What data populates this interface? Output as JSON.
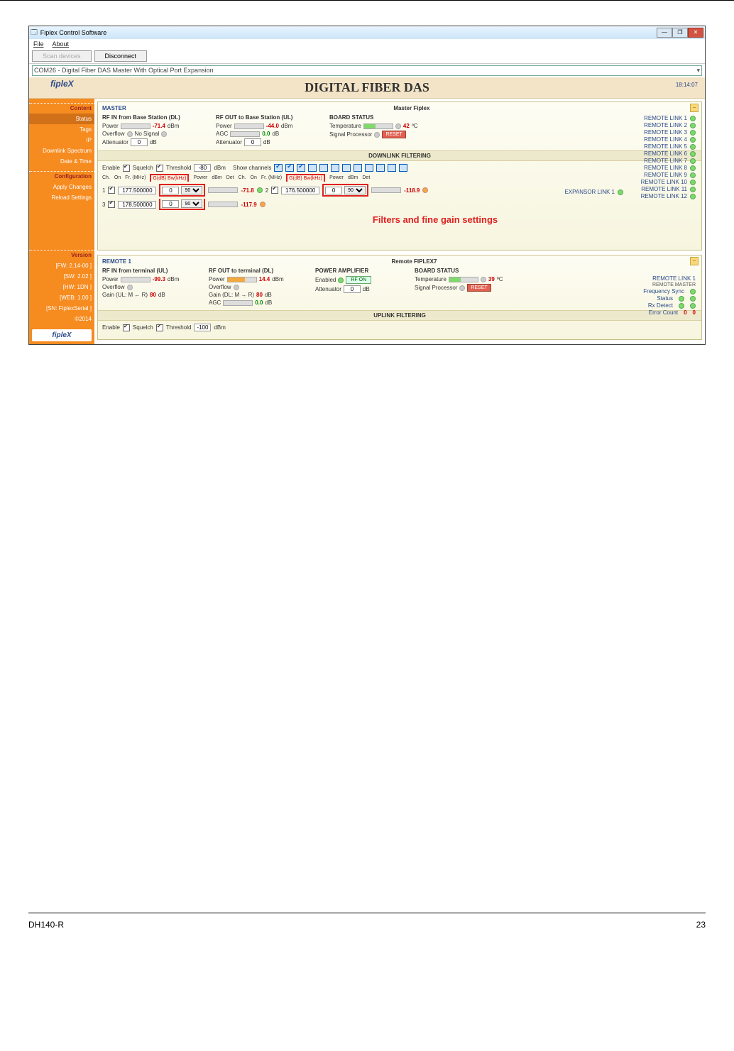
{
  "window": {
    "title": "Fiplex Control Software"
  },
  "menu": {
    "file": "File",
    "about": "About"
  },
  "toolbar": {
    "scan": "Scan devices",
    "disconnect": "Disconnect"
  },
  "combo": "COM26 - Digital Fiber DAS Master With Optical Port Expansion",
  "banner": {
    "logo": "fipleX",
    "title": "DIGITAL FIBER DAS",
    "time": "18:14:07"
  },
  "sidebar": {
    "content": "Content",
    "status": "Status",
    "tags": "Tags",
    "ip": "IP",
    "spectrum": "Downlink Spectrum",
    "datetime": "Date & Time",
    "config": "Configuration",
    "apply": "Apply Changes",
    "reload": "Reload Settings",
    "version": "Version",
    "v1": "[FW: 2.14-00 ]",
    "v2": "[SW: 2.02 ]",
    "v3": "[HW:  1DN ]",
    "v4": "[WEB: 1.00 ]",
    "v5": "[SN: FiplexSerial ]",
    "copy": "©2014",
    "logo": "fipleX"
  },
  "master": {
    "label": "MASTER",
    "name": "Master Fiplex",
    "rfin": {
      "h": "RF IN from Base Station (DL)",
      "power": "Power",
      "power_v": "-71.4",
      "dbm": "dBm",
      "overflow": "Overflow",
      "nosignal": "No Signal",
      "att": "Attenuator",
      "att_v": "0",
      "db": "dB"
    },
    "rfout": {
      "h": "RF OUT to Base Station (UL)",
      "power": "Power",
      "power_v": "-44.0",
      "dbm": "dBm",
      "agc": "AGC",
      "agc_v": "0.0",
      "db": "dB",
      "att": "Attenuator",
      "att_v": "0"
    },
    "board": {
      "h": "BOARD STATUS",
      "temp": "Temperature",
      "temp_v": "42",
      "c": "ºC",
      "sp": "Signal Processor",
      "reset": "RESET"
    },
    "dlf": "DOWNLINK FILTERING",
    "enable": "Enable",
    "squelch": "Squelch",
    "threshold": "Threshold",
    "th_v": "-80",
    "dbm": "dBm",
    "showch": "Show channels",
    "cols": {
      "ch": "Ch.",
      "on": "On",
      "fr": "Fr. (MHz)",
      "gdb": "G(dB) Bw(kHz)",
      "power": "Power",
      "dbm": "dBm",
      "det": "Det"
    },
    "r1": {
      "ch": "1",
      "fr": "177.500000",
      "g": "0",
      "bw": "90",
      "pw": "-71.8"
    },
    "r2": {
      "ch": "2",
      "fr": "176.500000",
      "g": "0",
      "bw": "90",
      "pw": "-118.9"
    },
    "r3": {
      "ch": "3",
      "fr": "178.500000",
      "g": "0",
      "bw": "90",
      "pw": "-117.9"
    },
    "annot": "Filters and fine gain settings",
    "exp": "EXPANSOR LINK 1",
    "links": [
      "REMOTE LINK 1",
      "REMOTE LINK 2",
      "REMOTE LINK 3",
      "REMOTE LINK 4",
      "REMOTE LINK 5",
      "REMOTE LINK 6",
      "REMOTE LINK 7",
      "REMOTE LINK 8",
      "REMOTE LINK 9",
      "REMOTE LINK 10",
      "REMOTE LINK 11",
      "REMOTE LINK 12"
    ]
  },
  "remote": {
    "label": "REMOTE 1",
    "name": "Remote FIPLEX7",
    "rfin": {
      "h": "RF IN from terminal (UL)",
      "power": "Power",
      "power_v": "-99.3",
      "dbm": "dBm",
      "overflow": "Overflow",
      "gain": "Gain (UL: M ← R)",
      "gain_v": "80",
      "db": "dB"
    },
    "rfout": {
      "h": "RF OUT to terminal (DL)",
      "power": "Power",
      "power_v": "14.4",
      "dbm": "dBm",
      "overflow": "Overflow",
      "gain": "Gain (DL: M → R)",
      "gain_v": "80",
      "db": "dB",
      "agc": "AGC",
      "agc_v": "0.0"
    },
    "pa": {
      "h": "POWER AMPLIFIER",
      "enabled": "Enabled",
      "rf_on": "RF ON",
      "att": "Attenuator",
      "att_v": "0",
      "db": "dB"
    },
    "board": {
      "h": "BOARD STATUS",
      "temp": "Temperature",
      "temp_v": "39",
      "c": "ºC",
      "sp": "Signal Processor",
      "reset": "RESET"
    },
    "ulf": "UPLINK FILTERING",
    "enable": "Enable",
    "squelch": "Squelch",
    "threshold": "Threshold",
    "th_v": "-100",
    "dbm": "dBm",
    "right": {
      "link": "REMOTE LINK 1",
      "hdr": "REMOTE MASTER",
      "fs": "Frequency Sync",
      "status": "Status",
      "rx": "Rx Detect",
      "err": "Error Count",
      "err_l": "0",
      "err_r": "0"
    }
  },
  "footer": {
    "left": "DH140-R",
    "right": "23"
  }
}
